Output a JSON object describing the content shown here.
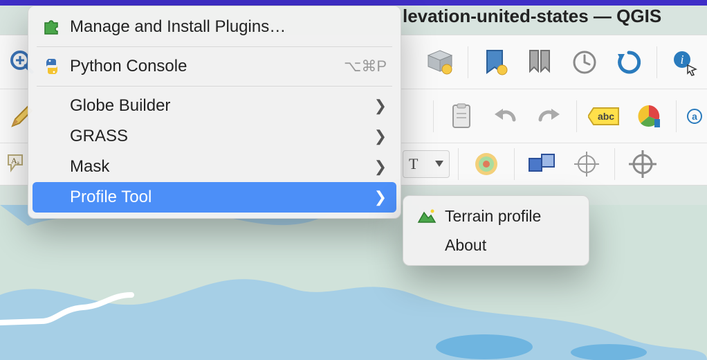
{
  "titlebar": {
    "text": "levation-united-states — QGIS"
  },
  "menu": {
    "manage_plugins": "Manage and Install Plugins…",
    "python_console": "Python Console",
    "python_shortcut": "⌥⌘P",
    "globe_builder": "Globe Builder",
    "grass": "GRASS",
    "mask": "Mask",
    "profile_tool": "Profile Tool"
  },
  "submenu": {
    "terrain_profile": "Terrain profile",
    "about": "About"
  },
  "icons": {
    "puzzle": "puzzle-icon",
    "python": "python-icon",
    "terrain": "terrain-icon"
  }
}
